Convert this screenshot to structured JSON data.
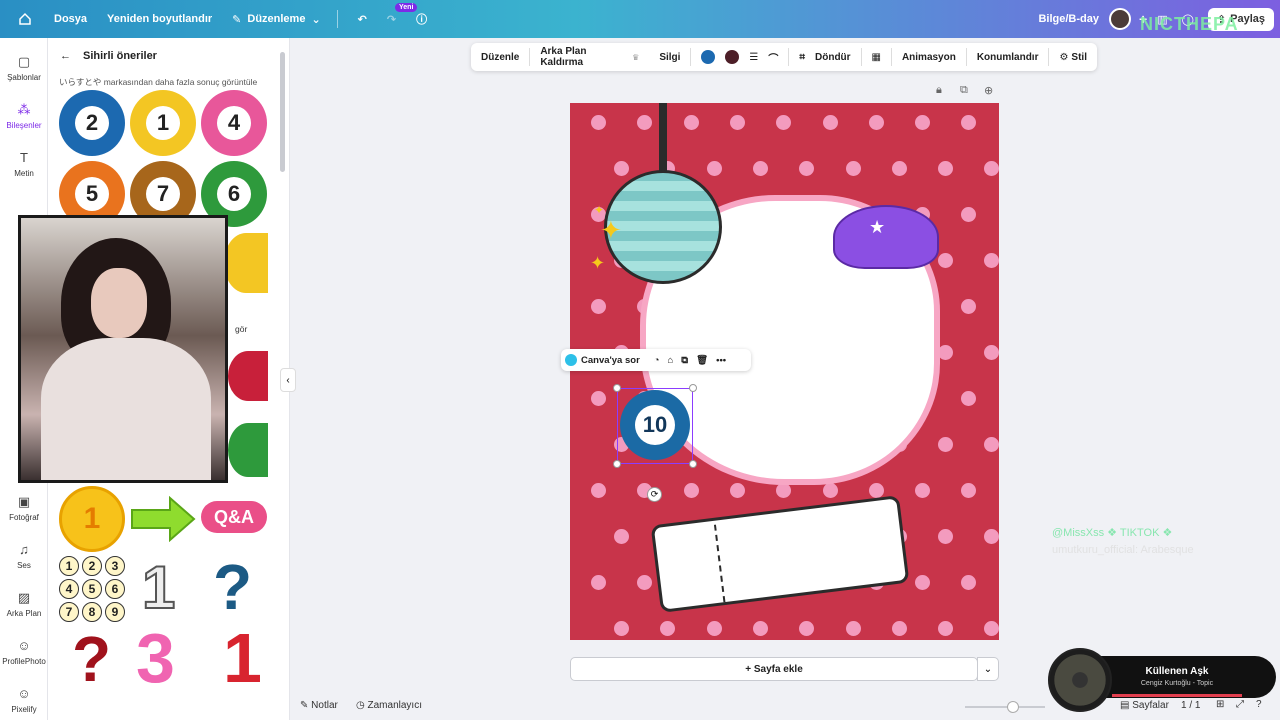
{
  "topbar": {
    "menu": [
      "Dosya",
      "Yeniden boyutlandır",
      "Düzenleme"
    ],
    "badge": "Yeni",
    "project_name": "Bilge/B-day",
    "share_label": "Paylaş",
    "watermark": "NICTHEPA"
  },
  "rail": [
    {
      "label": "Şablonlar",
      "icon": "template-icon"
    },
    {
      "label": "Bileşenler",
      "icon": "elements-icon"
    },
    {
      "label": "Metin",
      "icon": "text-icon"
    },
    {
      "label": "Fotoğraf",
      "icon": "photo-icon"
    },
    {
      "label": "Ses",
      "icon": "music-icon"
    },
    {
      "label": "Arka Plan",
      "icon": "background-icon"
    },
    {
      "label": "ProfilePhoto",
      "icon": "app-icon"
    },
    {
      "label": "Pixelify",
      "icon": "app-icon"
    }
  ],
  "panel": {
    "title": "Sihirli öneriler",
    "subtitle": "いらすとや markasından daha fazla sonuç görüntüle",
    "see_all": "gör",
    "balls": [
      {
        "num": "2",
        "color": "#1c69b0"
      },
      {
        "num": "1",
        "color": "#f3c623"
      },
      {
        "num": "4",
        "color": "#e8579a"
      },
      {
        "num": "5",
        "color": "#e9731e"
      },
      {
        "num": "7",
        "color": "#a7661b"
      },
      {
        "num": "6",
        "color": "#2e9a3c"
      }
    ],
    "numbers_grid": [
      "1",
      "2",
      "3",
      "4",
      "5",
      "6",
      "7",
      "8",
      "9"
    ],
    "qa_label": "Q&A",
    "big_one": "1",
    "three": "3",
    "red_one": "1"
  },
  "toolbar": {
    "items": [
      "Düzenle",
      "Arka Plan Kaldırma",
      "Silgi",
      "Döndür",
      "Animasyon",
      "Konumlandır",
      "Stil"
    ],
    "color1": "#1c69b0",
    "color2": "#4d1f28"
  },
  "context_menu": {
    "ask_label": "Canva'ya sor"
  },
  "canvas": {
    "selected_ball": "10",
    "bg": "#c8344a"
  },
  "add_page": "+ Sayfa ekle",
  "bottom": {
    "notes": "Notlar",
    "timer": "Zamanlayıcı",
    "pages": "Sayfalar",
    "page_count": "1 / 1"
  },
  "overlay": {
    "tiktok_line1": "@MissXss ❖ TIKTOK ❖",
    "tiktok_line2": "umutkuru_official: Arabesque",
    "song_title": "Küllenen Aşk",
    "song_artist": "Cengiz Kurtoğlu - Topic"
  }
}
